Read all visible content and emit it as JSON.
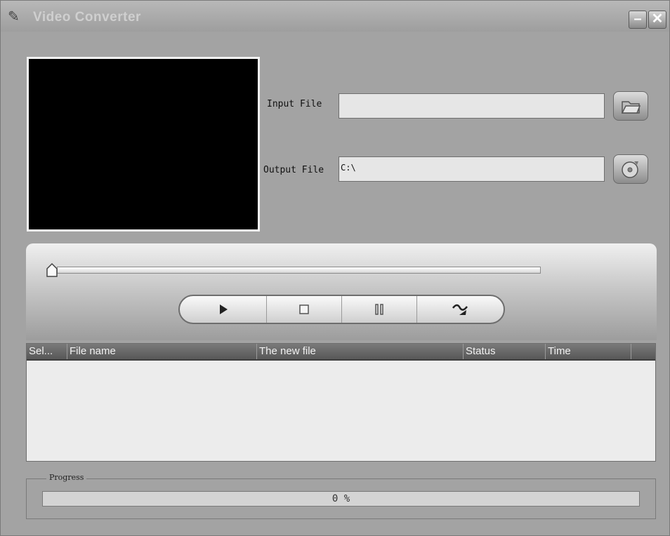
{
  "window": {
    "title": "Video Converter",
    "icon": "app-icon",
    "minimize_symbol": "–",
    "close_symbol": "✕"
  },
  "input": {
    "label": "Input File",
    "value": "",
    "button_icon": "folder-open-icon"
  },
  "output": {
    "label": "Output File",
    "value": "C:\\",
    "button_icon": "disc-icon"
  },
  "player": {
    "seek_position": 0,
    "controls": [
      "play-icon",
      "stop-icon",
      "pause-icon",
      "convert-icon"
    ]
  },
  "file_list": {
    "columns": [
      "Sel...",
      "File name",
      "The new file",
      "Status",
      "Time"
    ],
    "rows": []
  },
  "progress": {
    "label": "Progress",
    "value_percent": 0,
    "text": "0 %"
  }
}
